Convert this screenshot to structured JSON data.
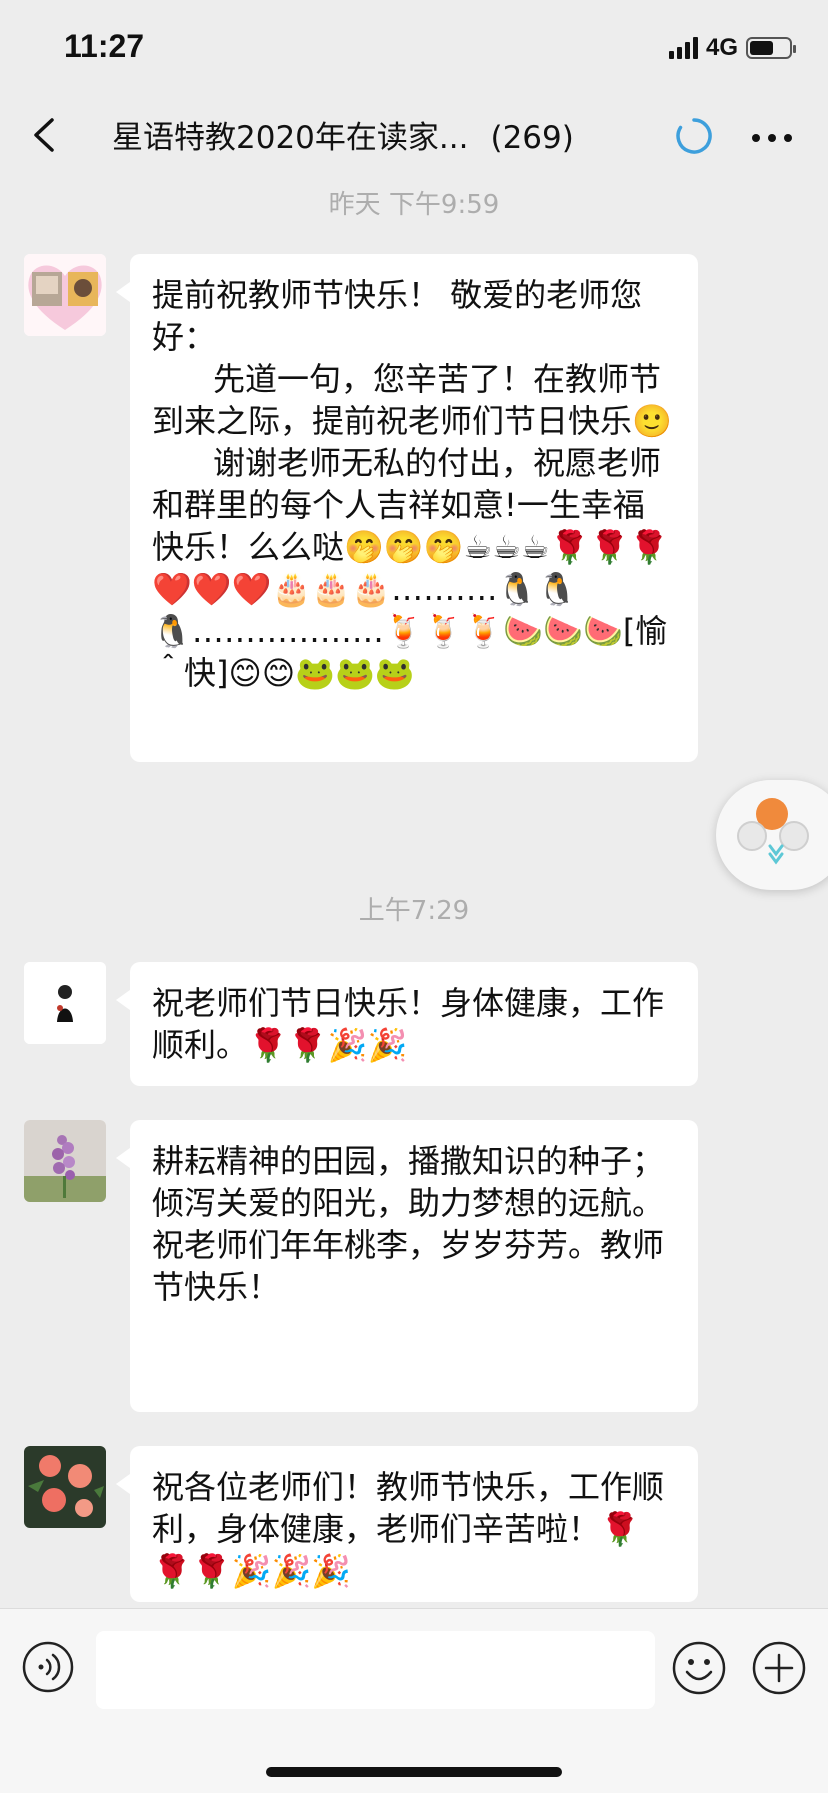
{
  "status_bar": {
    "time": "11:27",
    "network": "4G",
    "battery_level": 0.6
  },
  "header": {
    "title": "星语特教2020年在读家...",
    "member_count": "(269)"
  },
  "messages": [
    {
      "time": "昨天 下午9:59",
      "text": "提前祝教师节快乐！ 敬爱的老师您好：\n      先道一句，您辛苦了！在教师节到来之际，提前祝老师们节日快乐🙂\n      谢谢老师无私的付出，祝愿老师和群里的每个人吉祥如意!一生幸福快乐！么么哒🤭🤭🤭☕☕☕🌹🌹🌹❤️❤️❤️🎂🎂🎂……….🐧🐧🐧………………🍹🍹🍹🍉🍉🍉[愉＾快]😊😊🐸🐸🐸"
    },
    {
      "time": "上午7:29",
      "text": "祝老师们节日快乐！身体健康，工作顺利。🌹🌹🎉🎉"
    },
    {
      "text": "耕耘精神的田园，播撒知识的种子；\n倾泻关爱的阳光，助力梦想的远航。\n祝老师们年年桃李，岁岁芬芳。教师节快乐！"
    },
    {
      "text": "祝各位老师们！教师节快乐，工作顺利，身体健康，老师们辛苦啦！🌹🌹🌹🎉🎉🎉"
    }
  ],
  "input": {
    "placeholder": ""
  },
  "icons": {
    "back": "chevron-left-icon",
    "sync": "sync-spinner-icon",
    "more": "more-dots-icon",
    "voice": "voice-icon",
    "emoji": "emoji-face-icon",
    "plus": "plus-icon"
  },
  "colors": {
    "background": "#ededed",
    "bubble": "#ffffff",
    "timestamp": "#adadad",
    "sync_accent": "#3d9fdc"
  }
}
